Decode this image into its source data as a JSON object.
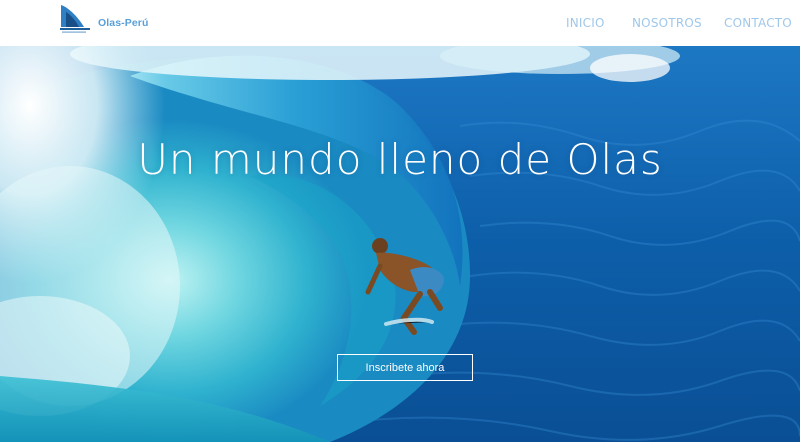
{
  "brand": {
    "name": "Olas-Perú",
    "logo_icon": "shark-fin-logo-icon"
  },
  "nav": {
    "items": [
      {
        "label": "INICIO"
      },
      {
        "label": "NOSOTROS"
      },
      {
        "label": "CONTACTO"
      }
    ]
  },
  "hero": {
    "headline": "Un mundo lleno de Olas",
    "cta_label": "Inscribete ahora",
    "image": "surfer-in-wave-barrel"
  },
  "colors": {
    "brand": "#5a9fd8",
    "nav": "#9fc7ea",
    "ocean_deep": "#0b5fa8",
    "wave_light": "#3fc3d6"
  }
}
